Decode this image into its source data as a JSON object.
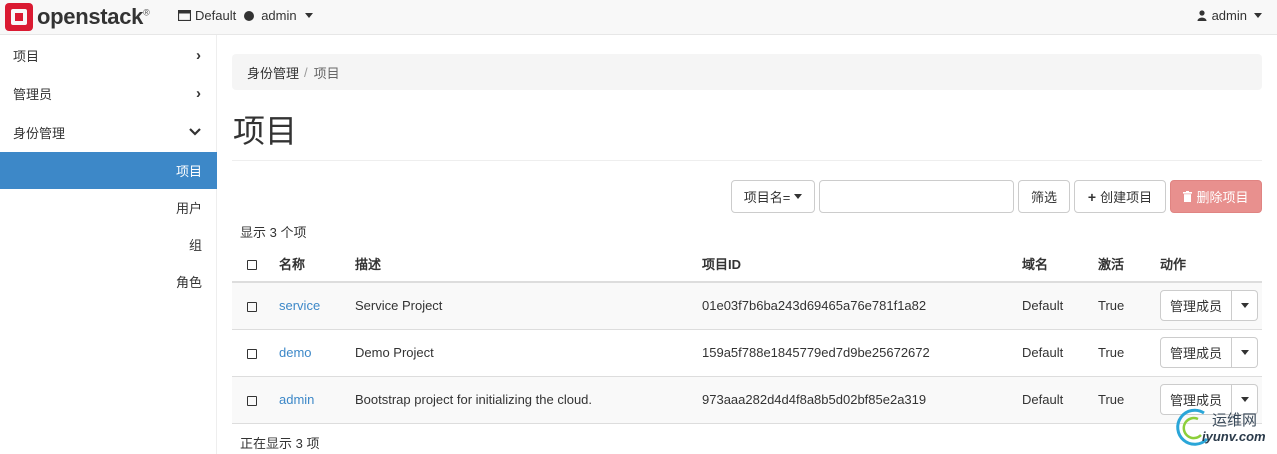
{
  "header": {
    "brand": "openstack",
    "brand_mark": "®",
    "domain": "Default",
    "project": "admin",
    "user": "admin"
  },
  "sidebar": {
    "items": [
      {
        "label": "项目",
        "expanded": false
      },
      {
        "label": "管理员",
        "expanded": false
      },
      {
        "label": "身份管理",
        "expanded": true
      }
    ],
    "sub_items": [
      {
        "label": "项目",
        "active": true
      },
      {
        "label": "用户",
        "active": false
      },
      {
        "label": "组",
        "active": false
      },
      {
        "label": "角色",
        "active": false
      }
    ]
  },
  "breadcrumb": {
    "parent": "身份管理",
    "separator": "/",
    "current": "项目"
  },
  "page_title": "项目",
  "toolbar": {
    "filter_field": "项目名=",
    "search_value": "",
    "filter_button": "筛选",
    "create_button": "创建项目",
    "delete_button": "删除项目"
  },
  "table": {
    "count_text": "显示 3 个项",
    "footer_text": "正在显示 3 项",
    "headers": {
      "name": "名称",
      "description": "描述",
      "id": "项目ID",
      "domain": "域名",
      "enabled": "激活",
      "actions": "动作"
    },
    "rows": [
      {
        "name": "service",
        "description": "Service Project",
        "id": "01e03f7b6ba243d69465a76e781f1a82",
        "domain": "Default",
        "enabled": "True",
        "action": "管理成员"
      },
      {
        "name": "demo",
        "description": "Demo Project",
        "id": "159a5f788e1845779ed7d9be25672672",
        "domain": "Default",
        "enabled": "True",
        "action": "管理成员"
      },
      {
        "name": "admin",
        "description": "Bootstrap project for initializing the cloud.",
        "id": "973aaa282d4d4f8a8b5d02bf85e2a319",
        "domain": "Default",
        "enabled": "True",
        "action": "管理成员"
      }
    ]
  },
  "watermark": {
    "cn": "运维网",
    "en": "iyunv.com"
  },
  "colors": {
    "accent": "#3d88c8",
    "danger": "#e8908e",
    "brand": "#da1a32"
  }
}
